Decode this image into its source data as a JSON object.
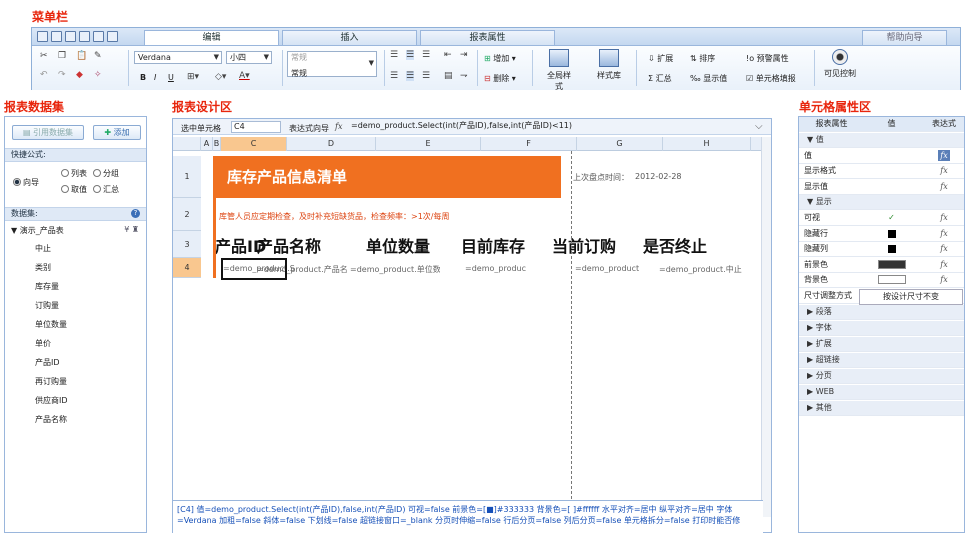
{
  "labels": {
    "menu": "菜单栏",
    "dataset": "报表数据集",
    "designer": "报表设计区",
    "cellprop": "单元格属性区"
  },
  "ribbon": {
    "tabs": [
      "编辑",
      "插入",
      "报表属性"
    ],
    "help": "帮助向导",
    "font": "Verdana",
    "size": "小四",
    "format1": "常规",
    "format2": "常规",
    "add": "增加",
    "del": "删除",
    "global_style": "全局样式",
    "style_lib": "样式库",
    "expand": "扩展",
    "sort": "排序",
    "alert": "预警属性",
    "summary": "汇总",
    "show_value": "显示值",
    "cell_fill": "单元格填报",
    "visible_ctrl": "可见控制",
    "bold": "B",
    "italic": "I",
    "underline": "U"
  },
  "left": {
    "btn_ref": "引用数据集",
    "btn_add": "添加",
    "quick": "快捷公式:",
    "r_guide": "向导",
    "r_list": "列表",
    "r_group": "分组",
    "r_value": "取值",
    "r_sum": "汇总",
    "dataset_label": "数据集:",
    "dataset_name": "演示_产品表",
    "fields": [
      "中止",
      "类别",
      "库存量",
      "订购量",
      "单位数量",
      "单价",
      "产品ID",
      "再订购量",
      "供应商ID",
      "产品名称"
    ]
  },
  "designer": {
    "sel_cell_label": "选中单元格",
    "sel_cell": "C4",
    "expr_label": "表达式向导",
    "fx": "fx",
    "formula": "=demo_product.Select(int(产品ID),false,int(产品ID)<11)",
    "cols": [
      "A",
      "B",
      "C",
      "D",
      "E",
      "F",
      "G",
      "H"
    ],
    "rows": [
      "1",
      "2",
      "3",
      "4"
    ],
    "title": "库存产品信息清单",
    "last_check_label": "上次盘点时间：",
    "last_check": "2012-02-28",
    "note": "库管人员应定期检查，及时补充短缺货品，检查频率：>1次/每周",
    "headers": [
      "产品ID",
      "产品名称",
      "单位数量",
      "目前库存",
      "当前订购",
      "是否终止"
    ],
    "data": [
      "=demo_product.S",
      "=demo_product.产品名",
      "=demo_product.单位数",
      "=demo_produc",
      "=demo_product",
      "=demo_product.中止"
    ],
    "bottom_info": "[C4] 值=demo_product.Select(int(产品ID),false,int(产品ID) 可视=false 前景色=[■]#333333 背景色=[ ]#ffffff 水平对齐=居中 纵平对齐=居中 字体=Verdana 加粗=false 斜体=false 下划线=false 超链接窗口=_blank 分页时伸缩=false 行后分页=false 列后分页=false 单元格拆分=false 打印时能否修"
  },
  "props": {
    "h_name": "报表属性",
    "h_val": "值",
    "h_expr": "表达式",
    "sec_value": "值",
    "value": "值",
    "disp_fmt": "显示格式",
    "disp_val": "显示值",
    "sec_show": "显示",
    "visible": "可视",
    "hide_row": "隐藏行",
    "hide_col": "隐藏列",
    "fg": "前景色",
    "bg": "背景色",
    "size_mode": "尺寸调整方式",
    "size_mode_val": "按设计尺寸不变",
    "sections": [
      "段落",
      "字体",
      "扩展",
      "超链接",
      "分页",
      "WEB",
      "其他"
    ],
    "fx": "fx",
    "check": "✓"
  },
  "colors": {
    "accent": "#f07020",
    "label_red": "#e8250c",
    "border": "#9ab6dc"
  }
}
